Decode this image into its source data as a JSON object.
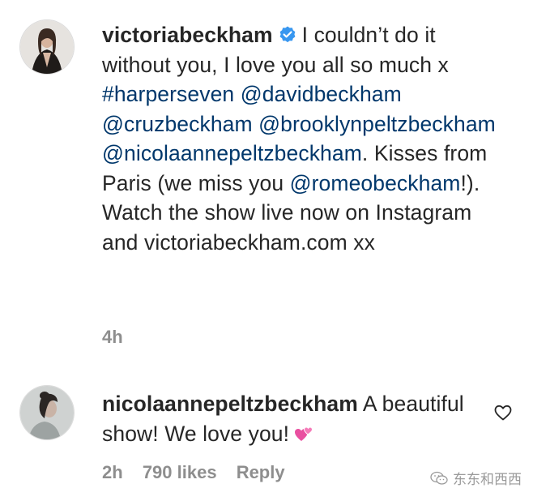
{
  "comments": [
    {
      "avatar_icon": "profile-photo",
      "username": "victoriabeckham",
      "verified": true,
      "segments": [
        {
          "text": "I couldn’t do it without you, I love you all so much x ",
          "link": false
        },
        {
          "text": "#harperseven",
          "link": true
        },
        {
          "text": " ",
          "link": false
        },
        {
          "text": "@davidbeckham",
          "link": true
        },
        {
          "text": " ",
          "link": false
        },
        {
          "text": "@cruzbeckham",
          "link": true
        },
        {
          "text": " ",
          "link": false
        },
        {
          "text": "@brooklynpeltzbeckham",
          "link": true
        },
        {
          "text": " ",
          "link": false
        },
        {
          "text": "@nicolaannepeltzbeckham",
          "link": true
        },
        {
          "text": ". Kisses from Paris (we miss you ",
          "link": false
        },
        {
          "text": "@romeobeckham",
          "link": true
        },
        {
          "text": "!). Watch the show live now on Instagram and victoriabeckham.com xx",
          "link": false
        }
      ],
      "time": "4h"
    },
    {
      "avatar_icon": "profile-photo",
      "username": "nicolaannepeltzbeckham",
      "text": "A beautiful show! We love you!",
      "emoji": "two-hearts-emoji",
      "time": "2h",
      "likes": "790 likes",
      "reply_label": "Reply",
      "like_icon": "heart-outline-icon"
    }
  ],
  "watermark": {
    "icon": "wechat-icon",
    "text": "东东和西西"
  },
  "colors": {
    "text": "#262626",
    "link": "#00376b",
    "secondary": "#8e8e8e",
    "verified": "#3897f0",
    "emoji_pink": "#e94fa0"
  }
}
